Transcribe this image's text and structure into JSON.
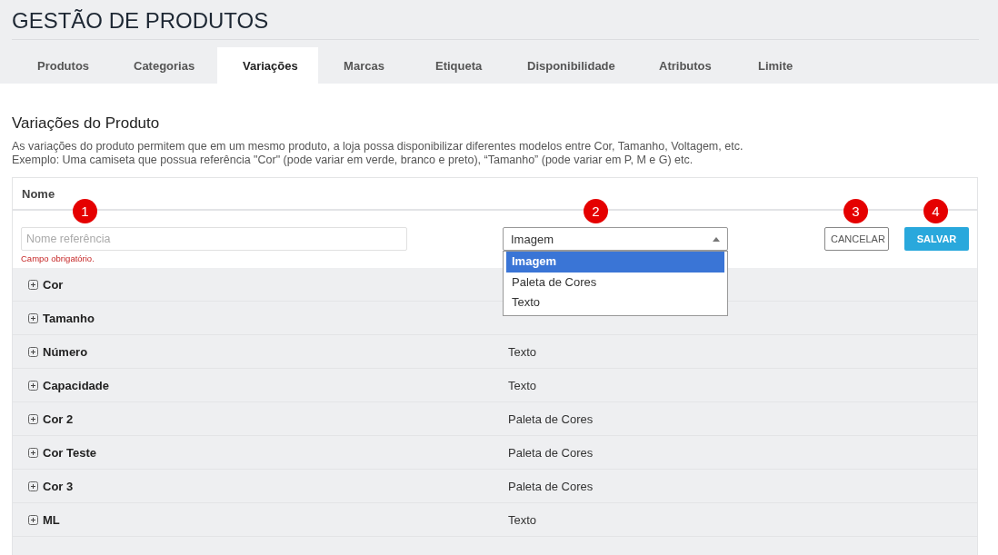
{
  "page_title": "GESTÃO DE PRODUTOS",
  "tabs": [
    {
      "label": "Produtos",
      "selected": false
    },
    {
      "label": "Categorias",
      "selected": false
    },
    {
      "label": "Variações",
      "selected": true
    },
    {
      "label": "Marcas",
      "selected": false
    },
    {
      "label": "Etiqueta",
      "selected": false
    },
    {
      "label": "Disponibilidade",
      "selected": false
    },
    {
      "label": "Atributos",
      "selected": false
    },
    {
      "label": "Limite",
      "selected": false
    }
  ],
  "section": {
    "heading": "Variações do Produto",
    "description_lines": [
      "As variações do produto permitem que em um mesmo produto, a loja possa disponibilizar diferentes modelos entre Cor, Tamanho, Voltagem, etc.",
      "Exemplo: Uma camiseta que possua referência \"Cor\" (pode variar em verde, branco e preto), “Tamanho” (pode variar em P, M e G) etc."
    ]
  },
  "table": {
    "column_header": "Nome",
    "form": {
      "name_field": {
        "placeholder": "Nome referência",
        "error": "Campo obrigatório."
      },
      "type_select": {
        "value": "Imagem",
        "expanded": true,
        "options": [
          {
            "label": "Imagem",
            "selected": true
          },
          {
            "label": "Paleta de Cores",
            "selected": false
          },
          {
            "label": "Texto",
            "selected": false
          }
        ]
      },
      "cancel_button": "CANCELAR",
      "save_button": "SALVAR"
    },
    "rows": [
      {
        "name": "Cor"
      },
      {
        "name": "Tamanho"
      },
      {
        "name": "Número",
        "type": "Texto"
      },
      {
        "name": "Capacidade",
        "type": "Texto"
      },
      {
        "name": "Cor 2",
        "type": "Paleta de Cores"
      },
      {
        "name": "Cor Teste",
        "type": "Paleta de Cores"
      },
      {
        "name": "Cor 3",
        "type": "Paleta de Cores"
      },
      {
        "name": "ML",
        "type": "Texto"
      }
    ]
  },
  "callouts": [
    "1",
    "2",
    "3",
    "4"
  ]
}
